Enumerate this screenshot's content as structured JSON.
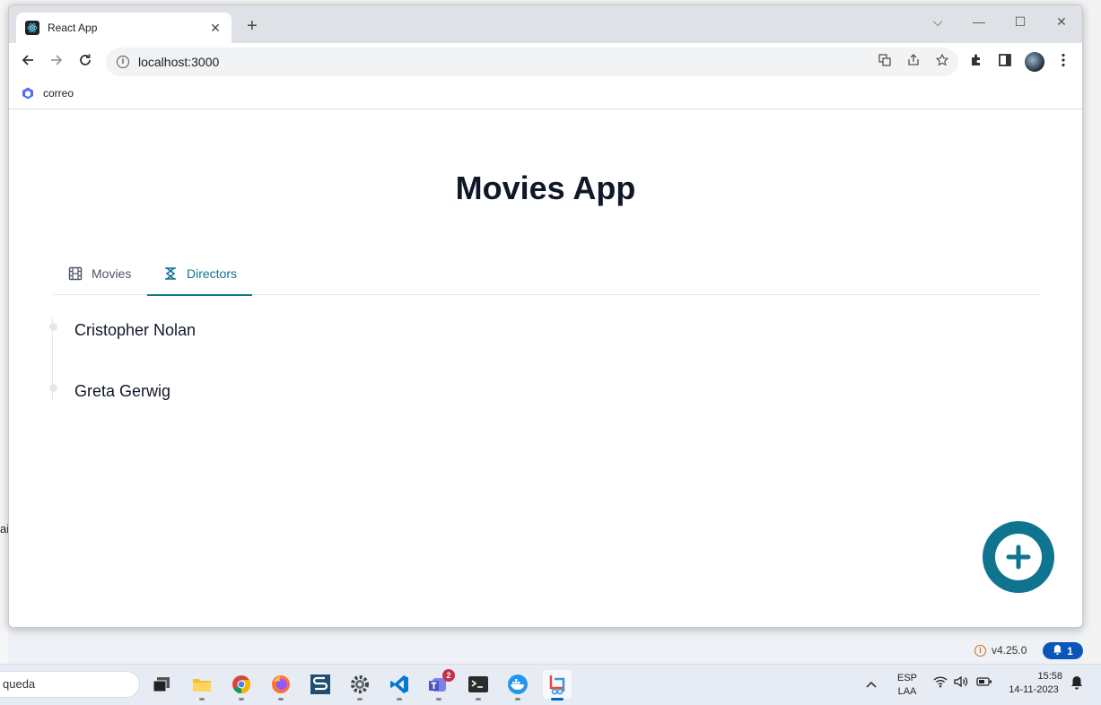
{
  "browser": {
    "tab_title": "React App",
    "tab_close": "✕",
    "new_tab": "+",
    "url": "localhost:3000",
    "bookmark_label": "correo",
    "window_controls": {
      "dropdown": "⌵",
      "minimize": "—",
      "maximize": "☐",
      "close": "✕"
    }
  },
  "app": {
    "title": "Movies App",
    "tabs": [
      {
        "label": "Movies",
        "icon": "film-icon",
        "active": false
      },
      {
        "label": "Directors",
        "icon": "director-icon",
        "active": true
      }
    ],
    "directors": [
      "Cristopher Nolan",
      "Greta Gerwig"
    ],
    "fab_icon": "plus-circle-icon",
    "accent_color": "#0e7490"
  },
  "status": {
    "version": "v4.25.0",
    "notification_count": "1"
  },
  "taskbar": {
    "search_text": "queda",
    "teams_badge": "2",
    "language": "ESP",
    "language_sub": "LAA",
    "time": "15:58",
    "date": "14-11-2023"
  },
  "background": {
    "left_edge_text": "ai"
  }
}
